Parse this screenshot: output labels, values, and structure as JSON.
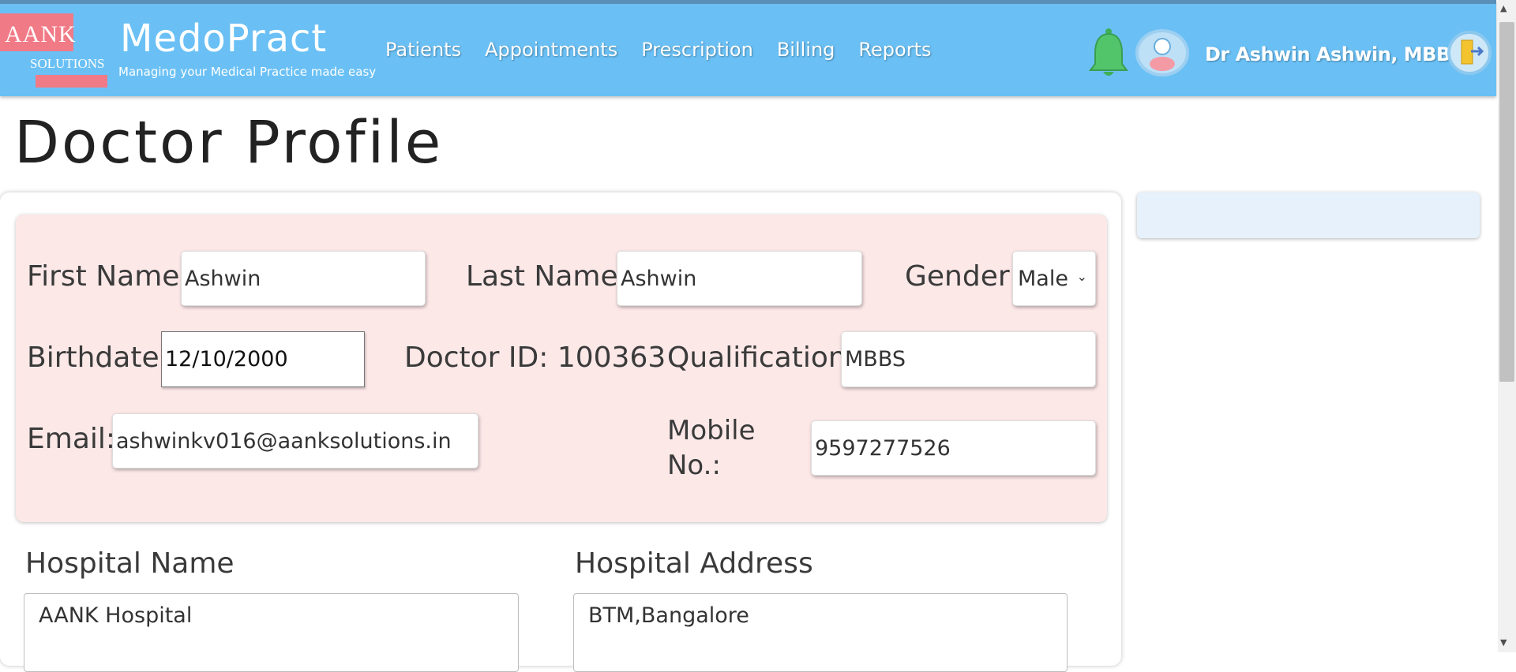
{
  "brand": {
    "logo_text": "AANK",
    "logo_sub": "SOLUTIONS",
    "name": "MedoPract",
    "tagline": "Managing your Medical Practice made easy"
  },
  "nav": {
    "items": [
      {
        "label": "Patients"
      },
      {
        "label": "Appointments"
      },
      {
        "label": "Prescription"
      },
      {
        "label": "Billing"
      },
      {
        "label": "Reports"
      }
    ]
  },
  "user": {
    "display_name": "Dr Ashwin  Ashwin, MBBS"
  },
  "page": {
    "title": "Doctor Profile"
  },
  "profile": {
    "first_name_label": "First Name:",
    "first_name": "Ashwin",
    "last_name_label": "Last Name:",
    "last_name": "Ashwin",
    "gender_label": "Gender:",
    "gender": "Male",
    "birthdate_label": "Birthdate:",
    "birthdate": "12/10/2000",
    "doctor_id_text": "Doctor ID: 100363",
    "qualification_label": "Qualification:",
    "qualification": "MBBS",
    "email_label": "Email:",
    "email": "ashwinkv016@aanksolutions.in",
    "mobile_label_line1": "Mobile",
    "mobile_label_line2": "No.:",
    "mobile": "9597277526"
  },
  "hospital": {
    "name_label": "Hospital Name",
    "name": "AANK Hospital",
    "address_label": "Hospital Address",
    "address": "BTM,Bangalore"
  },
  "colors": {
    "header": "#6ac0f5",
    "panel": "#fde8e8",
    "logo_accent": "#f07a86",
    "bell": "#52c46a"
  },
  "icons": [
    "bell-icon",
    "user-avatar-icon",
    "logout-icon",
    "chevron-down-icon"
  ]
}
